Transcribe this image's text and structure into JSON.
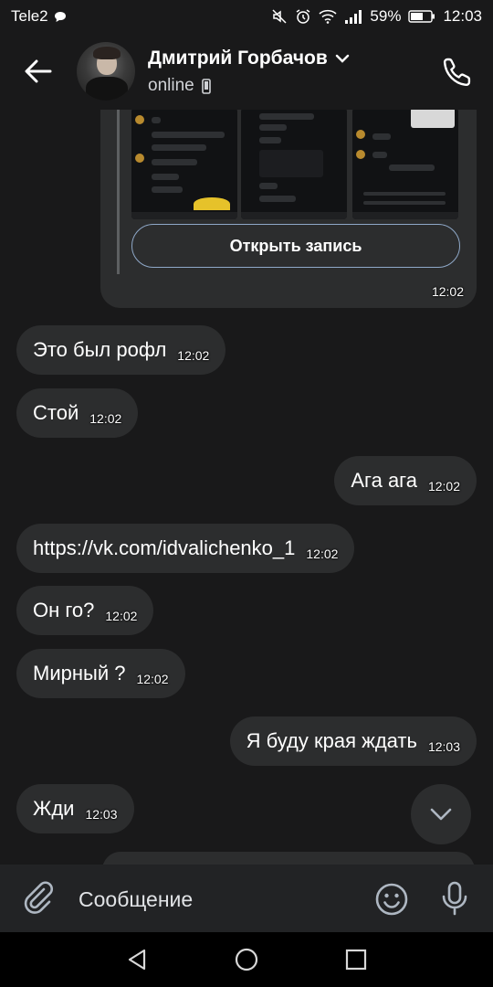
{
  "status_bar": {
    "carrier": "Tele2",
    "battery": "59%",
    "time": "12:03"
  },
  "header": {
    "contact_name": "Дмитрий Горбачов",
    "status": "online"
  },
  "shared_card": {
    "button_label": "Открыть запись",
    "time": "12:02"
  },
  "messages": [
    {
      "direction": "in",
      "text": "Это был рофл",
      "time": "12:02"
    },
    {
      "direction": "in",
      "text": "Стой",
      "time": "12:02"
    },
    {
      "direction": "out",
      "text": "Ага ага",
      "time": "12:02"
    },
    {
      "direction": "in",
      "text": "https://vk.com/idvalichenko_1",
      "time": "12:02"
    },
    {
      "direction": "in",
      "text": "Он го?",
      "time": "12:02"
    },
    {
      "direction": "in",
      "text": "Мирный ?",
      "time": "12:02"
    },
    {
      "direction": "out",
      "text": "Я буду края ждать",
      "time": "12:03"
    },
    {
      "direction": "in",
      "text": "Жди",
      "time": "12:03"
    }
  ],
  "composer": {
    "placeholder": "Сообщение"
  },
  "icons": {
    "back": "arrow-left-icon",
    "call": "phone-icon",
    "attach": "paperclip-icon",
    "emoji": "smiley-icon",
    "mic": "microphone-icon",
    "scroll_down": "chevron-down-icon"
  },
  "colors": {
    "background": "#19191a",
    "bubble": "#2c2d2e",
    "button_outline": "#8fa8c8",
    "text": "#ffffff"
  }
}
